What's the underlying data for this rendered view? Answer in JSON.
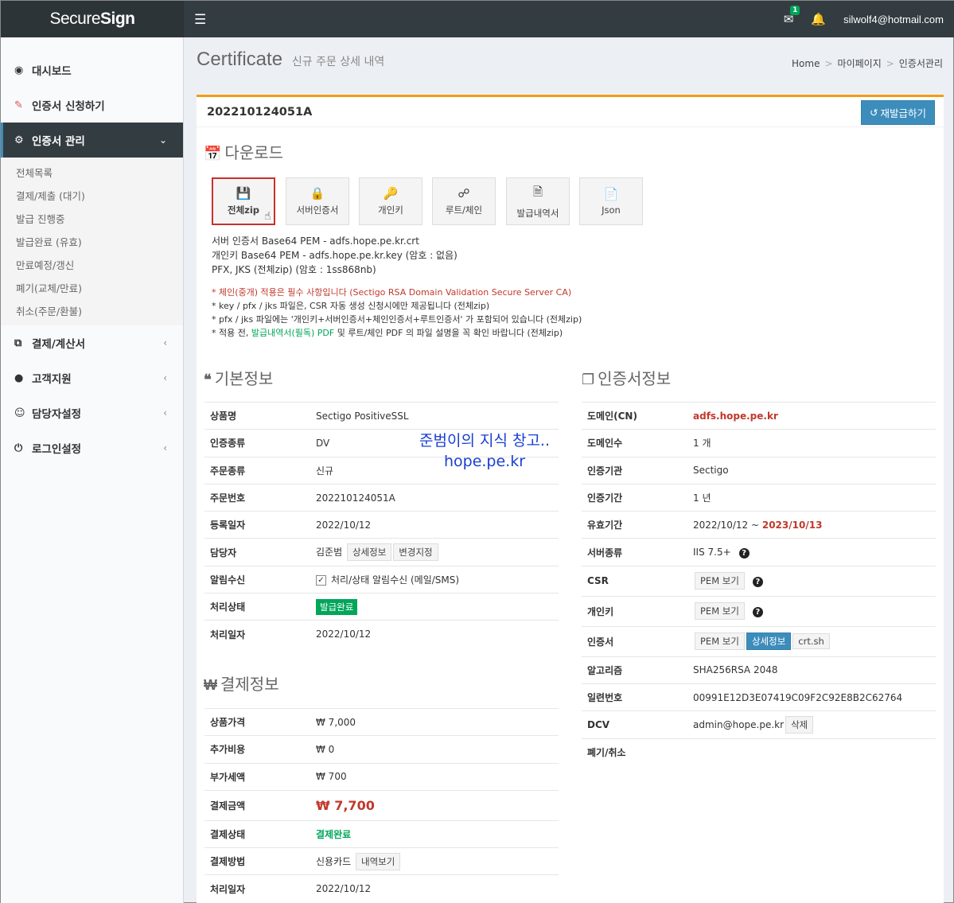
{
  "header": {
    "logo_light": "Secure",
    "logo_bold": "Sign",
    "mail_count": "1",
    "user_email": "silwolf4@hotmail.com"
  },
  "sidebar": {
    "items": [
      {
        "label": "대시보드",
        "icon": "dashboard-icon"
      },
      {
        "label": "인증서 신청하기",
        "icon": "edit-icon"
      },
      {
        "label": "인증서 관리",
        "icon": "gears-icon"
      },
      {
        "label": "결제/계산서",
        "icon": "copy-icon"
      },
      {
        "label": "고객지원",
        "icon": "comments-icon"
      },
      {
        "label": "담당자설정",
        "icon": "users-icon"
      },
      {
        "label": "로그인설정",
        "icon": "power-icon"
      }
    ],
    "subitems": [
      "전체목록",
      "결제/제출 (대기)",
      "발급 진행중",
      "발급완료 (유효)",
      "만료예정/갱신",
      "폐기(교체/만료)",
      "취소(주문/환불)"
    ]
  },
  "content_header": {
    "title": "Certificate",
    "subtitle": "신규 주문 상세 내역",
    "breadcrumb": [
      "Home",
      "마이페이지",
      "인증서관리"
    ]
  },
  "box": {
    "order_no": "202210124051A",
    "reissue_label": "재발급하기"
  },
  "download": {
    "title": "다운로드",
    "buttons": [
      {
        "label": "전체zip",
        "icon": "floppy-icon"
      },
      {
        "label": "서버인증서",
        "icon": "lock-icon"
      },
      {
        "label": "개인키",
        "icon": "key-icon"
      },
      {
        "label": "루트/체인",
        "icon": "share-icon"
      },
      {
        "label": "발급내역서",
        "icon": "pdf-icon"
      },
      {
        "label": "Json",
        "icon": "code-file-icon"
      }
    ],
    "lines": [
      "서버 인증서 Base64 PEM - adfs.hope.pe.kr.crt",
      "개인키 Base64 PEM - adfs.hope.pe.kr.key (암호 : 없음)",
      "PFX, JKS (전체zip) (암호 : 1ss868nb)"
    ],
    "note1": "* 체인(중개) 적용은 필수 사항입니다 (Sectigo RSA Domain Validation Secure Server CA)",
    "note2": "* key / pfx / jks 파일은, CSR 자동 생성 신청시에만 제공됩니다 (전체zip)",
    "note3": "* pfx / jks 파일에는 '개인키+서버인증서+체인인증서+루트인증서' 가 포함되어 있습니다 (전체zip)",
    "note4_a": "* 적용 전, ",
    "note4_b": "발급내역서(필독) PDF",
    "note4_c": " 및 루트/체인 PDF 의 파일 설명을 꼭 확인 바랍니다 (전체zip)"
  },
  "basic_info": {
    "title": "기본정보",
    "rows": {
      "product_label": "상품명",
      "product": "Sectigo PositiveSSL",
      "auth_type_label": "인증종류",
      "auth_type": "DV",
      "order_type_label": "주문종류",
      "order_type": "신규",
      "order_no_label": "주문번호",
      "order_no": "202210124051A",
      "reg_date_label": "등록일자",
      "reg_date": "2022/10/12",
      "manager_label": "담당자",
      "manager": "김준범",
      "detail_btn": "상세정보",
      "change_btn": "변경지정",
      "notify_label": "알림수신",
      "notify_text": "처리/상태 알림수신 (메일/SMS)",
      "status_label": "처리상태",
      "status": "발급완료",
      "proc_date_label": "처리일자",
      "proc_date": "2022/10/12"
    }
  },
  "payment_info": {
    "title": "결제정보",
    "rows": {
      "price_label": "상품가격",
      "price": "₩ 7,000",
      "extra_label": "추가비용",
      "extra": "₩ 0",
      "vat_label": "부가세액",
      "vat": "₩ 700",
      "total_label": "결제금액",
      "total": "₩ 7,700",
      "pay_status_label": "결제상태",
      "pay_status": "결제완료",
      "method_label": "결제방법",
      "method": "신용카드",
      "history_btn": "내역보기",
      "proc_date_label": "처리일자",
      "proc_date": "2022/10/12"
    }
  },
  "cert_info": {
    "title": "인증서정보",
    "rows": {
      "domain_label": "도메인(CN)",
      "domain": "adfs.hope.pe.kr",
      "domain_count_label": "도메인수",
      "domain_count": "1 개",
      "ca_label": "인증기관",
      "ca": "Sectigo",
      "period_label": "인증기간",
      "period": "1 년",
      "valid_label": "유효기간",
      "valid_from": "2022/10/12 ~ ",
      "valid_to": "2023/10/13",
      "server_label": "서버종류",
      "server": "IIS 7.5+",
      "csr_label": "CSR",
      "pem_btn": "PEM 보기",
      "key_label": "개인키",
      "cert_label": "인증서",
      "detail_btn": "상세정보",
      "crtsh_btn": "crt.sh",
      "algo_label": "알고리즘",
      "algo": "SHA256RSA 2048",
      "serial_label": "일련번호",
      "serial": "00991E12D3E07419C09F2C92E8B2C62764",
      "dcv_label": "DCV",
      "dcv": "admin@hope.pe.kr",
      "delete_btn": "삭제",
      "revoke_label": "폐기/취소"
    }
  },
  "watermark": {
    "line1": "준범이의 지식 창고..",
    "line2": "hope.pe.kr"
  }
}
